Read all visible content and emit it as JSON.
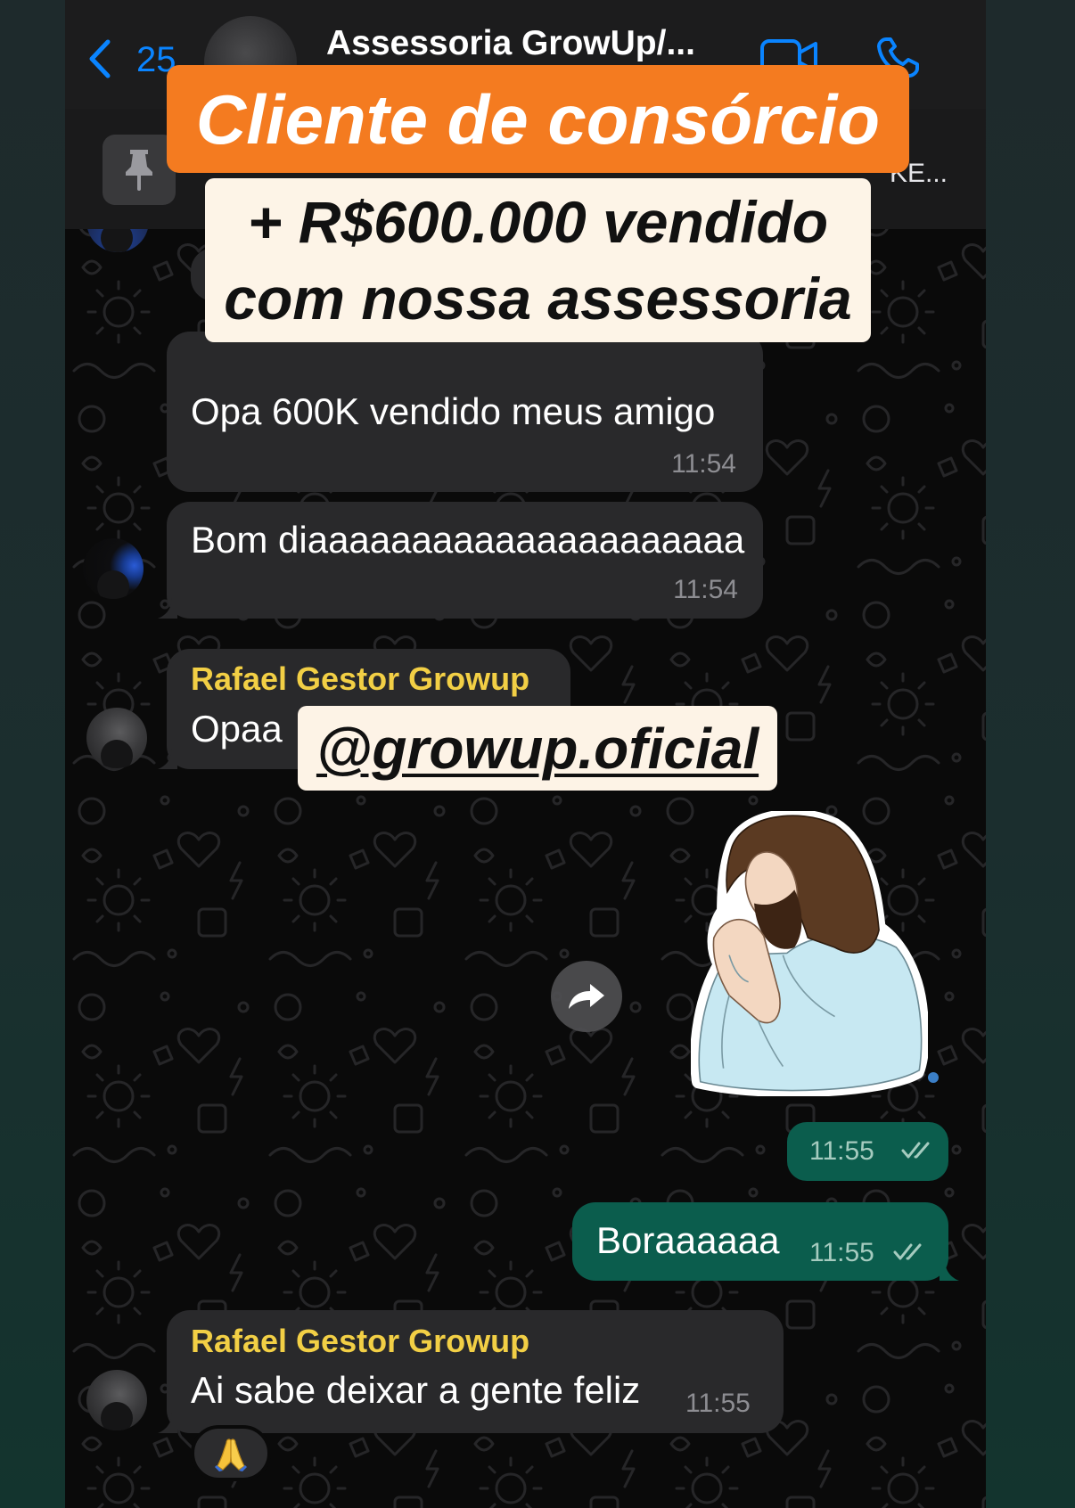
{
  "header": {
    "back_count": "25",
    "title": "Assessoria GrowUp/...",
    "icons": [
      "chevron-left-icon",
      "video-call-icon",
      "phone-call-icon"
    ]
  },
  "pinned": {
    "icon": "pin-icon",
    "text": "KE..."
  },
  "overlays": {
    "headline": "Cliente de consórcio",
    "subline_1": "+ R$600.000 vendido",
    "subline_2": "com nossa assessoria",
    "handle": "@growup.oficial"
  },
  "messages": [
    {
      "direction": "incoming",
      "text": "Opa 600K vendido meus amigo",
      "time": "11:54"
    },
    {
      "direction": "incoming",
      "text": "Bom diaaaaaaaaaaaaaaaaaaaaa",
      "time": "11:54"
    },
    {
      "direction": "incoming",
      "sender": "Rafael Gestor Growup",
      "text": "Opaa"
    },
    {
      "direction": "outgoing",
      "type": "sticker",
      "icon": "praying-figure-sticker",
      "time": "11:55",
      "status": "read"
    },
    {
      "direction": "outgoing",
      "text": "Boraaaaaa",
      "time": "11:55",
      "status": "read"
    },
    {
      "direction": "incoming",
      "sender": "Rafael Gestor Growup",
      "text": "Ai sabe deixar a gente feliz",
      "time": "11:55",
      "reaction": "folded-hands-icon"
    }
  ],
  "colors": {
    "accent": "#0a84ff",
    "banner": "#f47b20",
    "overlay_cream": "#fdf4e7",
    "incoming_bubble": "#29292b",
    "outgoing_bubble": "#0b5d4d",
    "sender_name": "#f2cf45",
    "chat_background": "#0a0a0a"
  }
}
